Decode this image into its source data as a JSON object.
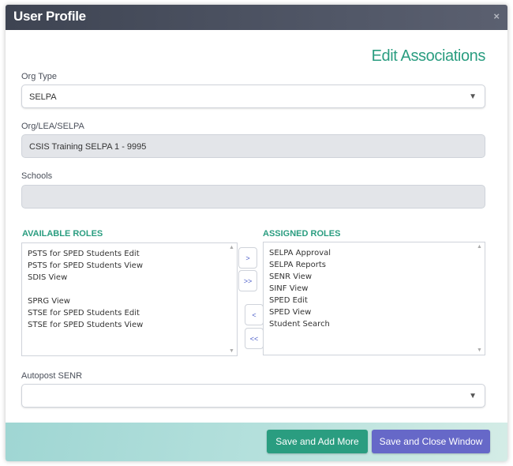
{
  "window": {
    "title": "User Profile",
    "close_icon": "×"
  },
  "heading": "Edit Associations",
  "org_type": {
    "label": "Org Type",
    "value": "SELPA",
    "arrow": "▼"
  },
  "org_lea_selpa": {
    "label": "Org/LEA/SELPA",
    "value": "CSIS Training SELPA 1 - 9995"
  },
  "schools": {
    "label": "Schools",
    "value": ""
  },
  "available_roles": {
    "label": "AVAILABLE ROLES",
    "items": [
      "PSTS for SPED Students Edit",
      "PSTS for SPED Students View",
      "SDIS View",
      "",
      "SPRG View",
      "STSE for SPED Students Edit",
      "STSE for SPED Students View"
    ]
  },
  "assigned_roles": {
    "label": "ASSIGNED ROLES",
    "items": [
      "SELPA Approval",
      "SELPA Reports",
      "SENR View",
      "SINF View",
      "SPED Edit",
      "SPED View",
      "Student Search"
    ]
  },
  "move_buttons": {
    "add": ">",
    "add_all": ">>",
    "remove": "<",
    "remove_all": "<<"
  },
  "scroll": {
    "up": "▲",
    "down": "▼"
  },
  "autopost": {
    "label": "Autopost SENR",
    "value": "",
    "arrow": "▼"
  },
  "footer": {
    "save_add": "Save and Add More",
    "save_close": "Save and Close Window"
  },
  "colors": {
    "accent_green": "#2a9d80",
    "accent_purple": "#6668c8",
    "header_bg": "#4a4f5e"
  }
}
